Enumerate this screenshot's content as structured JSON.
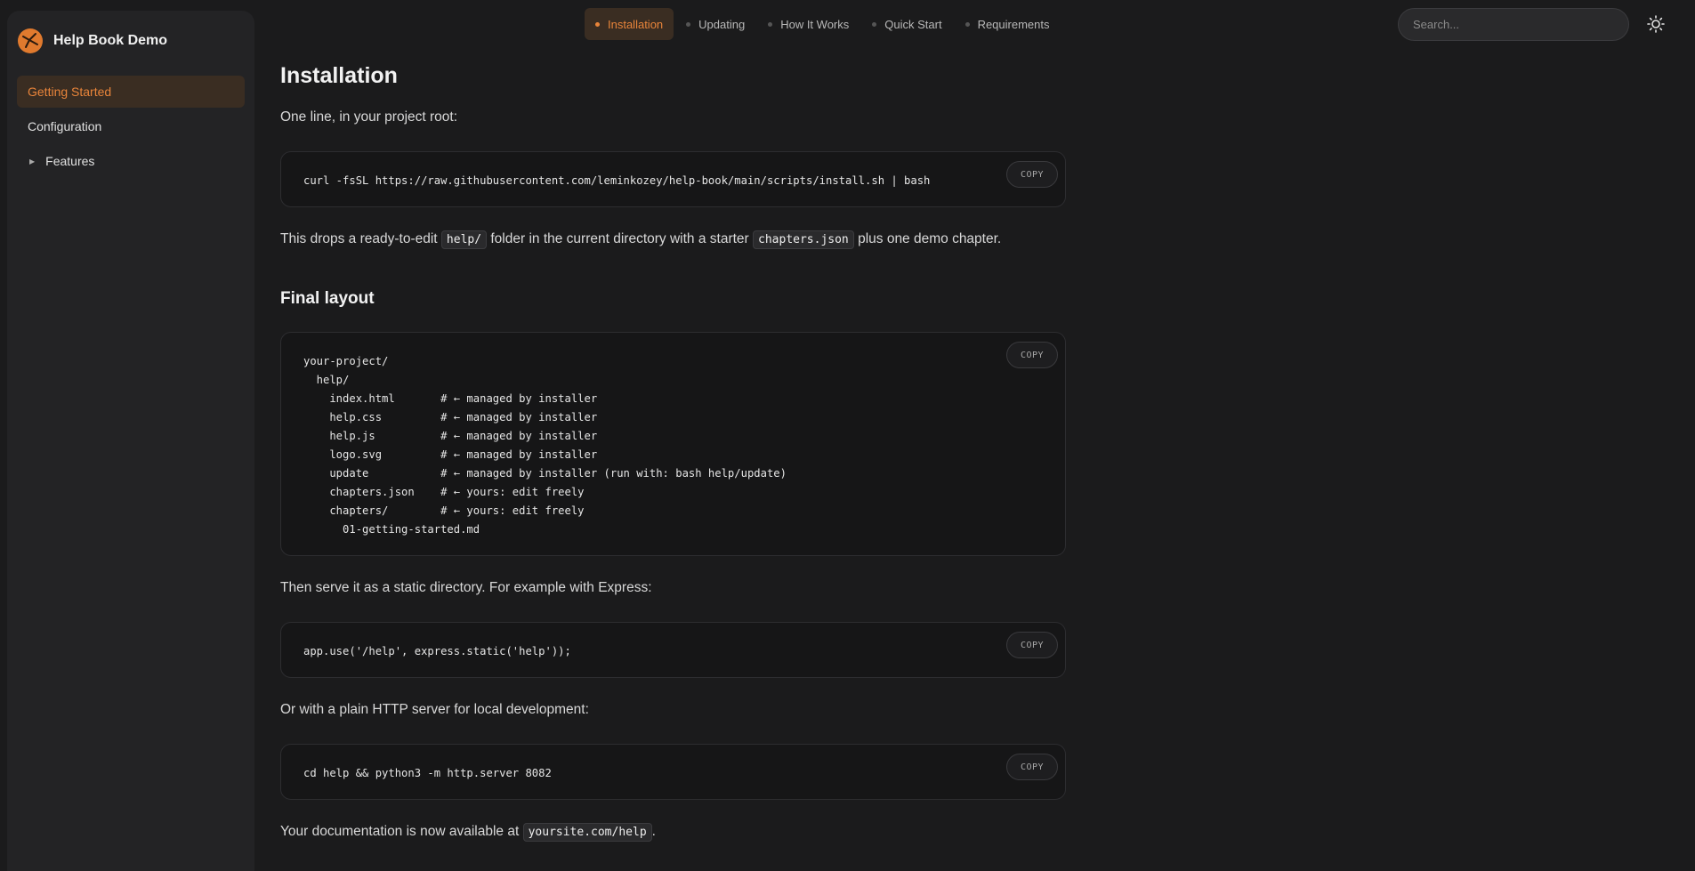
{
  "app": {
    "title": "Help Book Demo"
  },
  "sidebar": {
    "items": [
      {
        "label": "Getting Started",
        "active": true
      },
      {
        "label": "Configuration"
      },
      {
        "label": "Features",
        "expandable": true
      }
    ]
  },
  "topnav": {
    "tabs": [
      {
        "label": "Installation",
        "active": true
      },
      {
        "label": "Updating"
      },
      {
        "label": "How It Works"
      },
      {
        "label": "Quick Start"
      },
      {
        "label": "Requirements"
      }
    ]
  },
  "search": {
    "placeholder": "Search..."
  },
  "colors": {
    "accent": "#e8843a",
    "background": "#1b1b1c",
    "sidebar": "#232325"
  },
  "content": {
    "title": "Installation",
    "intro": "One line, in your project root:",
    "code_install": "curl -fsSL https://raw.githubusercontent.com/leminkozey/help-book/main/scripts/install.sh | bash",
    "drops_text_1": "This drops a ready-to-edit",
    "drops_code_1": "help/",
    "drops_text_2": "folder in the current directory with a starter",
    "drops_code_2": "chapters.json",
    "drops_text_3": "plus one demo chapter.",
    "final_layout_heading": "Final layout",
    "code_layout": "your-project/\n  help/\n    index.html       # ← managed by installer\n    help.css         # ← managed by installer\n    help.js          # ← managed by installer\n    logo.svg         # ← managed by installer\n    update           # ← managed by installer (run with: bash help/update)\n    chapters.json    # ← yours: edit freely\n    chapters/        # ← yours: edit freely\n      01-getting-started.md",
    "serve_text": "Then serve it as a static directory. For example with Express:",
    "code_express": "app.use('/help', express.static('help'));",
    "plain_text": "Or with a plain HTTP server for local development:",
    "code_python": "cd help && python3 -m http.server 8082",
    "available_text": "Your documentation is now available at",
    "available_code": "yoursite.com/help",
    "available_end": ".",
    "copy_label": "COPY"
  }
}
